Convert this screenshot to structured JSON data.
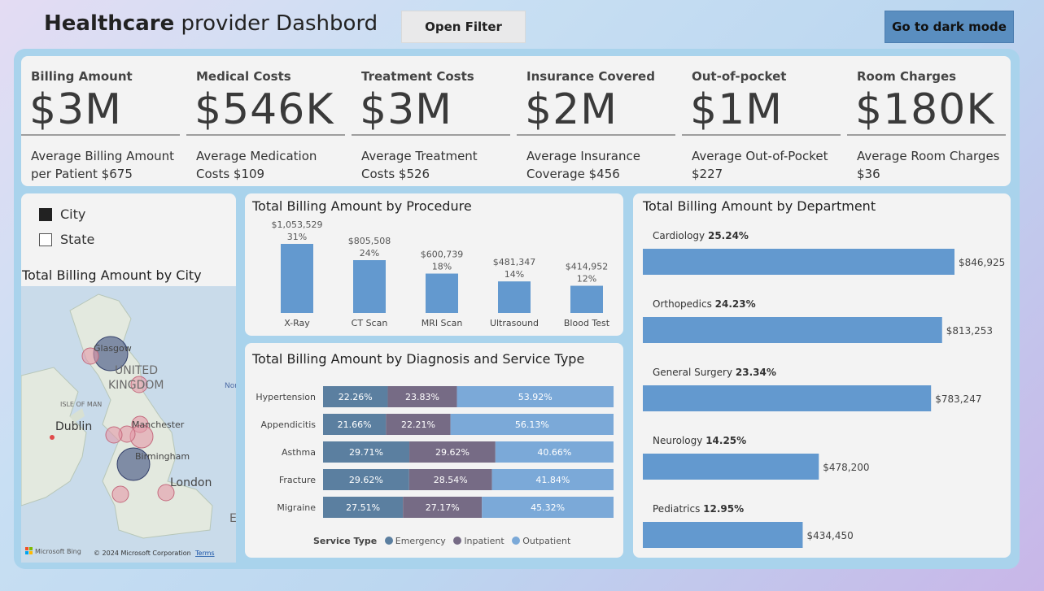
{
  "header": {
    "title_bold": "Healthcare",
    "title_rest": " provider Dashbord",
    "filter_button": "Open Filter",
    "dark_button": "Go to dark mode"
  },
  "kpis": [
    {
      "label": "Billing Amount",
      "value": "$3M",
      "sub": "Average Billing Amount per Patient $675"
    },
    {
      "label": "Medical Costs",
      "value": "$546K",
      "sub": "Average Medication Costs $109"
    },
    {
      "label": "Treatment Costs",
      "value": "$3M",
      "sub": "Average Treatment Costs $526"
    },
    {
      "label": "Insurance Covered",
      "value": "$2M",
      "sub": "Average Insurance Coverage $456"
    },
    {
      "label": "Out-of-pocket",
      "value": "$1M",
      "sub": "Average Out-of-Pocket $227"
    },
    {
      "label": "Room Charges",
      "value": "$180K",
      "sub": "Average Room Charges $36"
    }
  ],
  "toggle": {
    "city": "City",
    "state": "State",
    "selected": "City"
  },
  "map": {
    "title": "Total Billing Amount by City",
    "labels": {
      "glasgow": "Glasgow",
      "uk1": "UNITED",
      "uk2": "KINGDOM",
      "isle": "ISLE OF MAN",
      "dublin": "Dublin",
      "manchester": "Manchester",
      "birmingham": "Birmingham",
      "london": "London",
      "nor": "Nor",
      "e": "E"
    },
    "bing": "Microsoft Bing",
    "copyright": "© 2024 Microsoft Corporation",
    "terms": "Terms"
  },
  "colors": {
    "bar": "#6399cf",
    "emergency": "#5b7fa0",
    "inpatient": "#766b85",
    "outpatient": "#7ba9d8",
    "accent_dark_button": "#5a8ec0"
  },
  "chart_data": [
    {
      "type": "bar",
      "title": "Total Billing Amount by Procedure",
      "categories": [
        "X-Ray",
        "CT Scan",
        "MRI Scan",
        "Ultrasound",
        "Blood Test"
      ],
      "values": [
        1053529,
        805508,
        600739,
        481347,
        414952
      ],
      "value_labels": [
        "$1,053,529",
        "$805,508",
        "$600,739",
        "$481,347",
        "$414,952"
      ],
      "percent_labels": [
        "31%",
        "24%",
        "18%",
        "14%",
        "12%"
      ]
    },
    {
      "type": "bar",
      "orientation": "horizontal-stacked-100",
      "title": "Total Billing Amount by Diagnosis and Service Type",
      "categories": [
        "Hypertension",
        "Appendicitis",
        "Asthma",
        "Fracture",
        "Migraine"
      ],
      "legend_title": "Service Type",
      "series": [
        {
          "name": "Emergency",
          "values": [
            22.26,
            21.66,
            29.71,
            29.62,
            27.51
          ]
        },
        {
          "name": "Inpatient",
          "values": [
            23.83,
            22.21,
            29.62,
            28.54,
            27.17
          ]
        },
        {
          "name": "Outpatient",
          "values": [
            53.92,
            56.13,
            40.66,
            41.84,
            45.32
          ]
        }
      ]
    },
    {
      "type": "bar",
      "orientation": "horizontal",
      "title": "Total Billing Amount by Department",
      "categories": [
        "Cardiology",
        "Orthopedics",
        "General Surgery",
        "Neurology",
        "Pediatrics"
      ],
      "percent_labels": [
        "25.24%",
        "24.23%",
        "23.34%",
        "14.25%",
        "12.95%"
      ],
      "values": [
        846925,
        813253,
        783247,
        478200,
        434450
      ],
      "value_labels": [
        "$846,925",
        "$813,253",
        "$783,247",
        "$478,200",
        "$434,450"
      ]
    }
  ]
}
